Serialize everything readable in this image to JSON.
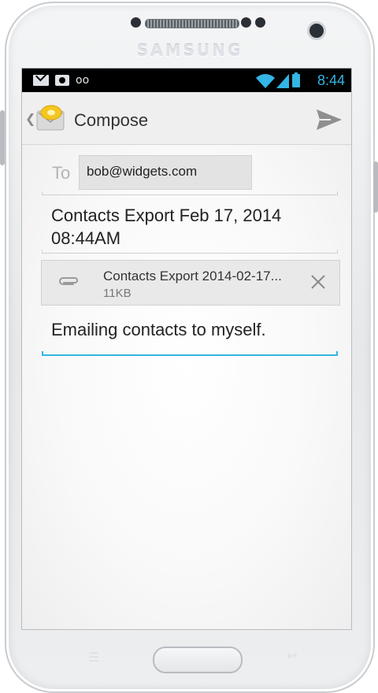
{
  "device": {
    "brand": "SAMSUNG"
  },
  "status_bar": {
    "time": "8:44",
    "voicemail_glyph": "oo",
    "icons": [
      "mail-icon",
      "camera-icon",
      "voicemail-icon",
      "wifi-icon",
      "signal-icon",
      "battery-icon"
    ],
    "accent_color": "#33b5e5"
  },
  "action_bar": {
    "title": "Compose",
    "icons": [
      "up-caret-icon",
      "email-app-icon",
      "send-icon"
    ]
  },
  "compose": {
    "to_label": "To",
    "recipient": "bob@widgets.com",
    "subject": "Contacts Export Feb 17, 2014 08:44AM",
    "attachment": {
      "name": "Contacts Export 2014-02-17...",
      "size": "11KB"
    },
    "body": "Emailing contacts to myself."
  }
}
